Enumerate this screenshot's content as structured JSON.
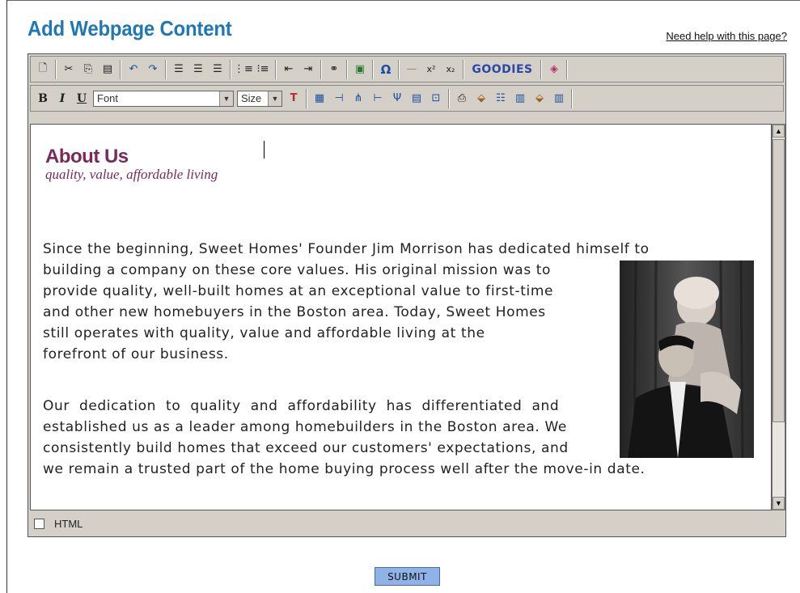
{
  "page": {
    "title": "Add Webpage Content",
    "help_link": "Need help with this page?"
  },
  "toolbar1": {
    "items": [
      {
        "name": "new-document-icon",
        "glyph": "🗋"
      },
      {
        "name": "cut-icon",
        "glyph": "✂"
      },
      {
        "name": "copy-icon",
        "glyph": "⎘"
      },
      {
        "name": "paste-icon",
        "glyph": "📋"
      },
      {
        "name": "undo-icon",
        "glyph": "↶"
      },
      {
        "name": "redo-icon",
        "glyph": "↷"
      },
      {
        "name": "align-left-icon",
        "glyph": "≡"
      },
      {
        "name": "align-center-icon",
        "glyph": "≡"
      },
      {
        "name": "align-right-icon",
        "glyph": "≡"
      },
      {
        "name": "ordered-list-icon",
        "glyph": "⒈"
      },
      {
        "name": "unordered-list-icon",
        "glyph": "☰"
      },
      {
        "name": "outdent-icon",
        "glyph": "⇤"
      },
      {
        "name": "indent-icon",
        "glyph": "⇥"
      },
      {
        "name": "link-icon",
        "glyph": "∞"
      },
      {
        "name": "image-icon",
        "glyph": "▣"
      },
      {
        "name": "special-char-icon",
        "glyph": "Ω"
      },
      {
        "name": "horizontal-rule-icon",
        "glyph": "—"
      },
      {
        "name": "superscript-icon",
        "glyph": "x²"
      },
      {
        "name": "subscript-icon",
        "glyph": "x₂"
      }
    ],
    "goodies_label": "GOODIES",
    "extra_icon": "eraser-icon"
  },
  "toolbar2": {
    "bold": "B",
    "italic": "I",
    "underline": "U",
    "font_select": "Font",
    "size_select": "Size",
    "icons": [
      "text-color-icon",
      "insert-table-icon",
      "insert-column-icon",
      "split-cell-icon",
      "insert-row-icon",
      "merge-cells-icon",
      "table-properties-icon",
      "cell-properties-icon",
      "page-properties-icon",
      "paint-icon",
      "row-height-icon",
      "column-width-icon",
      "fill-icon",
      "column-props-icon"
    ]
  },
  "content": {
    "heading": "About Us",
    "tagline": "quality, value, affordable living",
    "para1_lines": [
      "Since the beginning, Sweet Homes' Founder Jim Morrison has dedicated himself to",
      "building a company on these core values. His original mission was to",
      "provide quality, well-built homes at an exceptional value to first-time",
      "and other new homebuyers in the Boston area. Today, Sweet Homes",
      "still operates with quality, value and affordable living at the",
      "forefront of our business."
    ],
    "para2_lines": [
      "Our  dedication  to  quality  and  affordability  has  differentiated  and",
      "established us as a leader among homebuilders in the Boston area. We",
      "consistently build homes that exceed our customers' expectations, and",
      "we remain a trusted part of the home buying process well after the move-in date."
    ]
  },
  "footer": {
    "html_label": "HTML",
    "submit_label": "SUBMIT"
  }
}
